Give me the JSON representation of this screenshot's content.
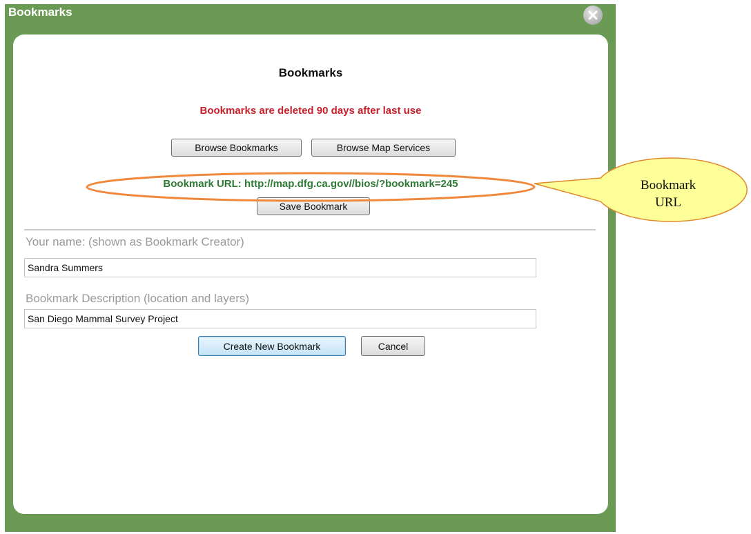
{
  "window": {
    "title": "Bookmarks",
    "close_icon": "close-icon"
  },
  "panel": {
    "heading": "Bookmarks",
    "warning": "Bookmarks are deleted 90 days after last use",
    "buttons": {
      "browse_bookmarks": "Browse Bookmarks",
      "browse_map_services": "Browse Map Services",
      "save_bookmark": "Save Bookmark",
      "create_new_bookmark": "Create New Bookmark",
      "cancel": "Cancel"
    },
    "bookmark_url": "Bookmark URL: http://map.dfg.ca.gov//bios/?bookmark=245",
    "form": {
      "name_label": "Your name: (shown as Bookmark Creator)",
      "name_value": "Sandra Summers",
      "description_label": "Bookmark Description (location and layers)",
      "description_value": "San Diego Mammal Survey Project"
    }
  },
  "annotation": {
    "callout_line1": "Bookmark",
    "callout_line2": "URL"
  },
  "colors": {
    "window_green": "#6b9a55",
    "warning_red": "#c4202a",
    "url_green": "#2f7a34",
    "annotation_orange": "#f0883c",
    "callout_fill": "#ffff99"
  }
}
